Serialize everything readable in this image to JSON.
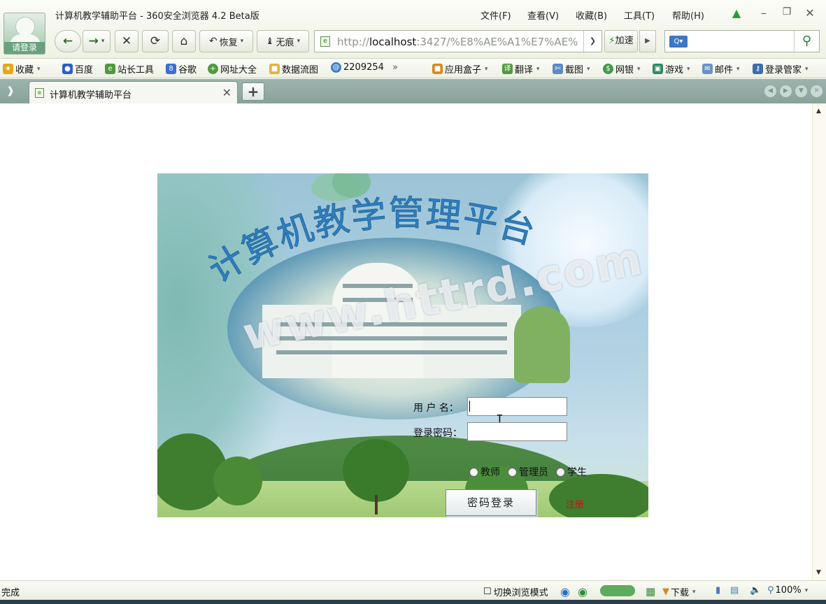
{
  "window": {
    "title": "计算机教学辅助平台 - 360安全浏览器 4.2 Beta版",
    "avatar_label": "请登录",
    "menus": [
      "文件(F)",
      "查看(V)",
      "收藏(B)",
      "工具(T)",
      "帮助(H)"
    ]
  },
  "toolbar": {
    "restore_label": "恢复",
    "incognito_label": "无痕",
    "address_prefix": "http://",
    "address_host": "localhost",
    "address_rest": ":3427/%E8%AE%A1%E7%AE%",
    "accelerate_label": "加速"
  },
  "favorites": {
    "collect_label": "收藏",
    "links": [
      "百度",
      "站长工具",
      "谷歌",
      "网址大全",
      "数据流图",
      "2209254"
    ],
    "more": "»",
    "tools": [
      "应用盒子",
      "翻译",
      "截图",
      "网银",
      "游戏",
      "邮件",
      "登录管家"
    ]
  },
  "tabs": {
    "active_title": "计算机教学辅助平台"
  },
  "login": {
    "heading": "计算机教学管理平台",
    "watermark": "www.httrd.com",
    "username_label": "用 户 名：",
    "username_value": "",
    "password_label": "登录密码：",
    "password_value": "",
    "roles": [
      "教师",
      "管理员",
      "学生"
    ],
    "submit_label": "密码登录",
    "register_label": "注册"
  },
  "statusbar": {
    "status_text": "完成",
    "mode_label": "切换浏览模式",
    "download_label": "下载",
    "zoom": "100%"
  },
  "colors": {
    "accent_green": "#2d6c24",
    "tab_strip": "#9db4ad",
    "heading_blue": "#2f7fbf",
    "register_red": "#c0131a"
  }
}
